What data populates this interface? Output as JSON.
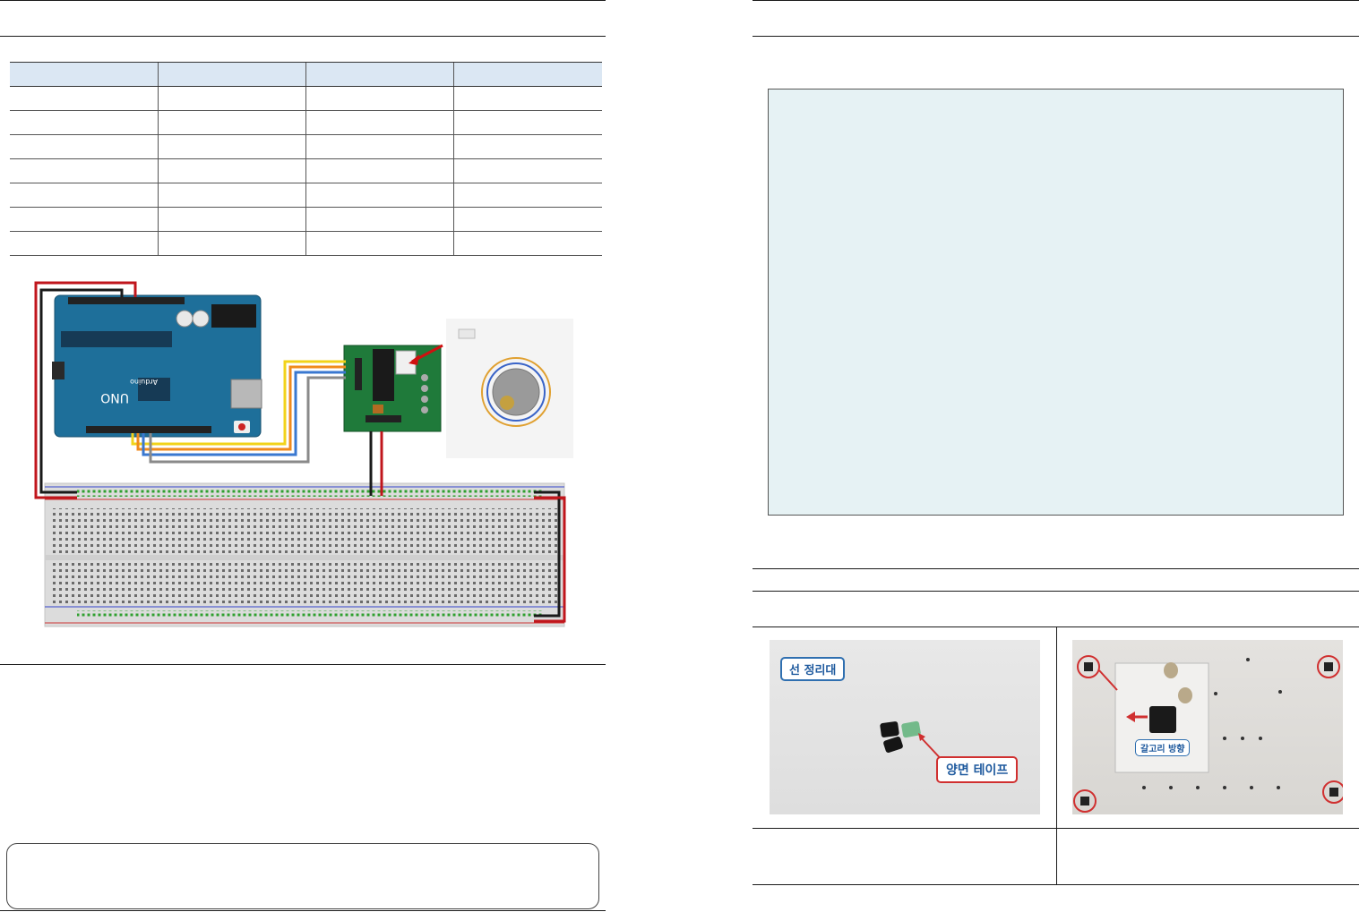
{
  "left_page": {
    "table": {
      "header": [
        "",
        "",
        "",
        ""
      ],
      "rows": [
        [
          "",
          "",
          "",
          ""
        ],
        [
          "",
          "",
          "",
          ""
        ],
        [
          "",
          "",
          "",
          ""
        ],
        [
          "",
          "",
          "",
          ""
        ],
        [
          "",
          "",
          "",
          ""
        ],
        [
          "",
          "",
          "",
          ""
        ],
        [
          "",
          "",
          "",
          ""
        ]
      ]
    },
    "diagram": {
      "board_text": "UNO",
      "brand_text": "Arduino"
    }
  },
  "right_page": {
    "photo_left": {
      "label_top": "선 정리대",
      "label_bottom": "양면 테이프"
    },
    "photo_right": {
      "label": "갈고리 방향"
    }
  },
  "colors": {
    "header_fill": "#dbe7f3",
    "code_fill": "#e6f2f4",
    "arduino_blue": "#1e6f9a",
    "driver_green": "#1f7a3a",
    "wire_red": "#c0161c",
    "wire_yellow": "#f2d31a",
    "wire_orange": "#f08a1c",
    "wire_blue": "#3a78d0",
    "wire_gray": "#8a8a8a",
    "callout_red": "#d03030",
    "callout_blue": "#2f6fb0"
  }
}
